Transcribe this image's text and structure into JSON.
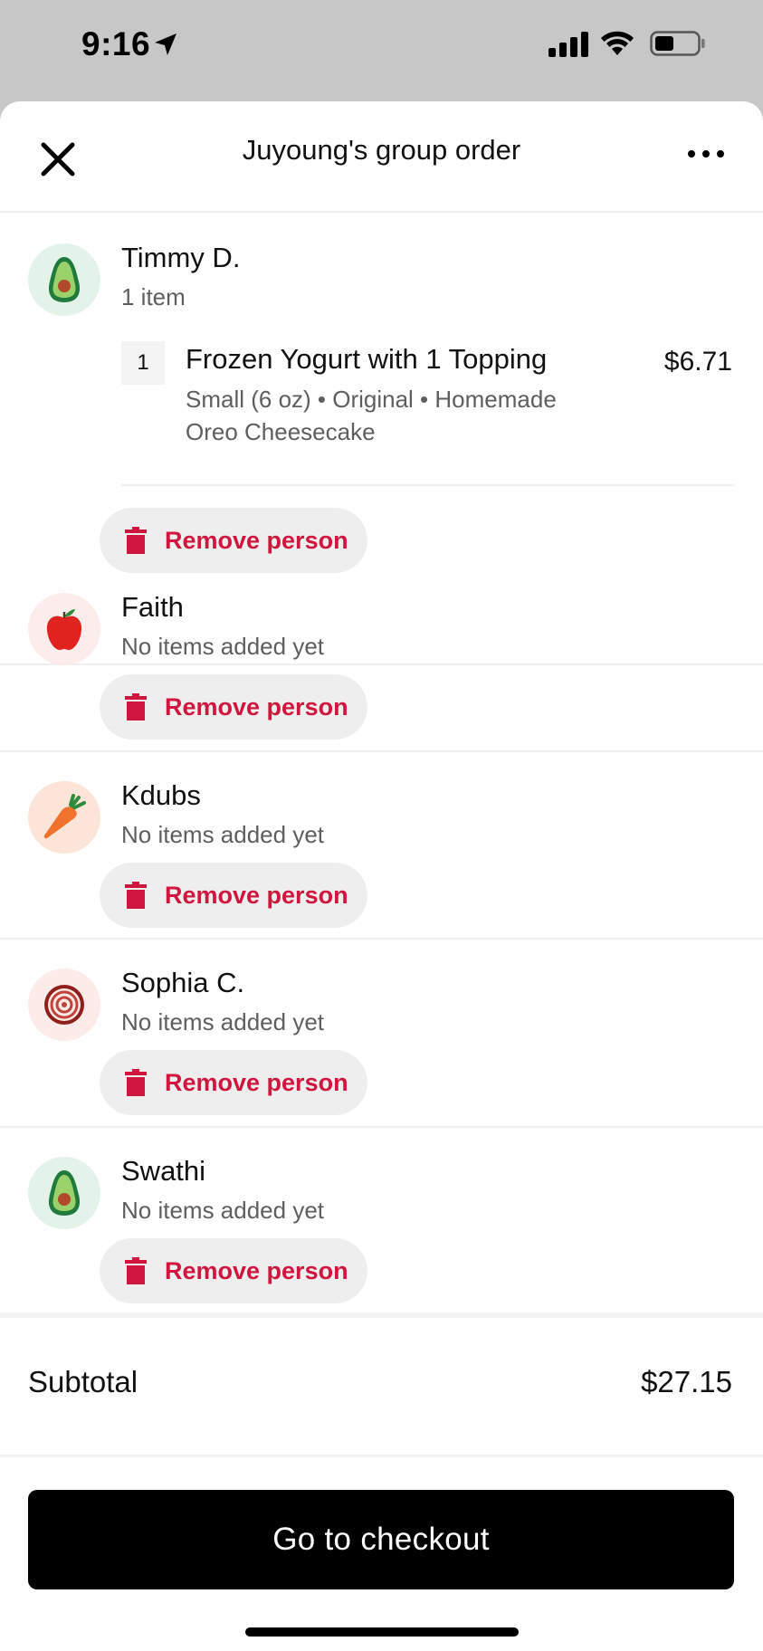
{
  "status_bar": {
    "time": "9:16",
    "icons": [
      "location-arrow-icon",
      "signal-icon",
      "wifi-icon",
      "battery-icon"
    ]
  },
  "header": {
    "title": "Juyoung's group order",
    "close_icon": "close-icon",
    "more_icon": "more-icon"
  },
  "people": [
    {
      "name": "Timmy D.",
      "subtitle": "1 item",
      "avatar": "avocado-icon",
      "items": [
        {
          "qty": "1",
          "name": "Frozen Yogurt with 1 Topping",
          "options": "Small (6 oz) • Original • Homemade Oreo Cheesecake",
          "price": "$6.71"
        }
      ],
      "remove_label": "Remove person"
    },
    {
      "name": "Faith",
      "subtitle": "No items added yet",
      "avatar": "apple-icon",
      "remove_label": "Remove person"
    },
    {
      "name": "Kdubs",
      "subtitle": "No items added yet",
      "avatar": "carrot-icon",
      "remove_label": "Remove person"
    },
    {
      "name": "Sophia C.",
      "subtitle": "No items added yet",
      "avatar": "onion-icon",
      "remove_label": "Remove person"
    },
    {
      "name": "Swathi",
      "subtitle": "No items added yet",
      "avatar": "avocado-icon",
      "remove_label": "Remove person"
    }
  ],
  "summary": {
    "subtotal_label": "Subtotal",
    "subtotal_value": "$27.15"
  },
  "checkout": {
    "label": "Go to checkout"
  },
  "colors": {
    "accent_red": "#d0163f",
    "status_bar_bg": "#c6c7c6",
    "button_bg": "#000000"
  }
}
